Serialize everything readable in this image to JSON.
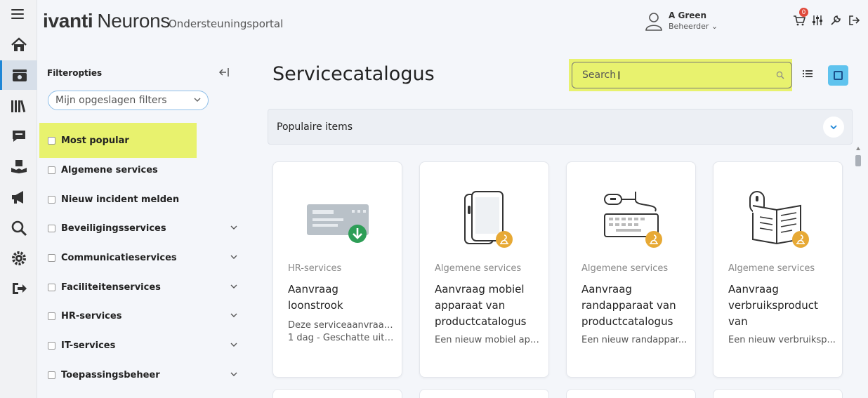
{
  "header": {
    "logo_brand": "ivanti",
    "logo_product": "Neurons",
    "portal_title": "Ondersteuningsportal",
    "user_name": "A Green",
    "user_role": "Beheerder ⌄",
    "cart_count": "0"
  },
  "filters": {
    "title": "Filteropties",
    "saved_filters_placeholder": "Mijn opgeslagen filters",
    "items": [
      {
        "label": "Most popular",
        "expandable": false
      },
      {
        "label": "Algemene services",
        "expandable": false
      },
      {
        "label": "Nieuw incident melden",
        "expandable": false
      },
      {
        "label": "Beveiligingsservices",
        "expandable": true
      },
      {
        "label": "Communicatieservices",
        "expandable": true
      },
      {
        "label": "Faciliteitenservices",
        "expandable": true
      },
      {
        "label": "HR-services",
        "expandable": true
      },
      {
        "label": "IT-services",
        "expandable": true
      },
      {
        "label": "Toepassingsbeheer",
        "expandable": true
      }
    ]
  },
  "main": {
    "page_title": "Servicecatalogus",
    "search_placeholder": "Search",
    "popular_label": "Populaire items",
    "cards": [
      {
        "category": "HR-services",
        "title": "Aanvraag loonstrook",
        "desc_line1": "Deze serviceaanvraag ...",
        "desc_line2": "1 dag - Geschatte uitv..."
      },
      {
        "category": "Algemene services",
        "title": "Aanvraag mobiel apparaat van productcatalogus",
        "desc_line1": "Een nieuw mobiel app...",
        "desc_line2": ""
      },
      {
        "category": "Algemene services",
        "title": "Aanvraag randapparaat van productcatalogus",
        "desc_line1": "Een nieuw randappar...",
        "desc_line2": ""
      },
      {
        "category": "Algemene services",
        "title": "Aanvraag verbruiksproduct van",
        "desc_line1": "Een nieuw verbruiksp...",
        "desc_line2": ""
      }
    ]
  },
  "colors": {
    "highlight": "#e8f26e",
    "accent": "#5fc3ee",
    "badge": "#e04a3c",
    "success": "#2e9e57",
    "gold": "#e7a935"
  }
}
